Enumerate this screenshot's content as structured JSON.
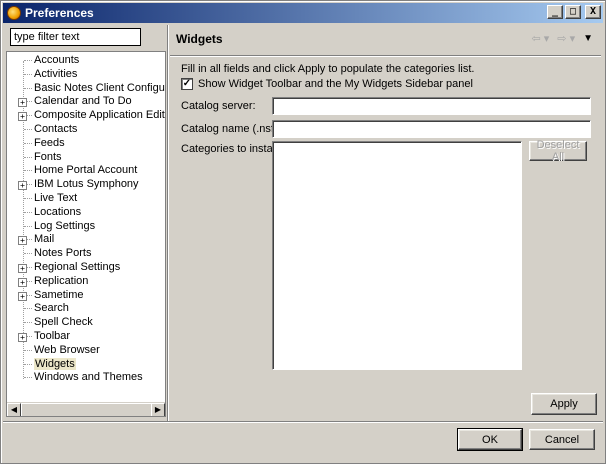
{
  "window": {
    "title": "Preferences"
  },
  "title_buttons": {
    "minimize": "_",
    "maximize": "□",
    "close": "X"
  },
  "filter": {
    "value": "type filter text"
  },
  "tree": {
    "items": [
      {
        "label": "Accounts",
        "expandable": false,
        "selected": false
      },
      {
        "label": "Activities",
        "expandable": false,
        "selected": false
      },
      {
        "label": "Basic Notes Client Configuration",
        "expandable": false,
        "selected": false
      },
      {
        "label": "Calendar and To Do",
        "expandable": true,
        "selected": false
      },
      {
        "label": "Composite Application Editor",
        "expandable": true,
        "selected": false
      },
      {
        "label": "Contacts",
        "expandable": false,
        "selected": false
      },
      {
        "label": "Feeds",
        "expandable": false,
        "selected": false
      },
      {
        "label": "Fonts",
        "expandable": false,
        "selected": false
      },
      {
        "label": "Home Portal Account",
        "expandable": false,
        "selected": false
      },
      {
        "label": "IBM Lotus Symphony",
        "expandable": true,
        "selected": false
      },
      {
        "label": "Live Text",
        "expandable": false,
        "selected": false
      },
      {
        "label": "Locations",
        "expandable": false,
        "selected": false
      },
      {
        "label": "Log Settings",
        "expandable": false,
        "selected": false
      },
      {
        "label": "Mail",
        "expandable": true,
        "selected": false
      },
      {
        "label": "Notes Ports",
        "expandable": false,
        "selected": false
      },
      {
        "label": "Regional Settings",
        "expandable": true,
        "selected": false
      },
      {
        "label": "Replication",
        "expandable": true,
        "selected": false
      },
      {
        "label": "Sametime",
        "expandable": true,
        "selected": false
      },
      {
        "label": "Search",
        "expandable": false,
        "selected": false
      },
      {
        "label": "Spell Check",
        "expandable": false,
        "selected": false
      },
      {
        "label": "Toolbar",
        "expandable": true,
        "selected": false
      },
      {
        "label": "Web Browser",
        "expandable": false,
        "selected": false
      },
      {
        "label": "Widgets",
        "expandable": false,
        "selected": true
      },
      {
        "label": "Windows and Themes",
        "expandable": false,
        "selected": false
      }
    ]
  },
  "page": {
    "title": "Widgets",
    "info": "Fill in all fields and click Apply to populate the categories list.",
    "show_toolbar": {
      "label": "Show Widget Toolbar and the My Widgets Sidebar panel",
      "checked": true
    },
    "catalog_server": {
      "label": "Catalog server:",
      "value": ""
    },
    "catalog_name": {
      "label": "Catalog name (.nsf):",
      "value": ""
    },
    "categories": {
      "label": "Categories to install:"
    },
    "deselect_all": "Deselect All",
    "apply": "Apply"
  },
  "icons": {
    "back": "back-arrow-icon",
    "forward": "forward-arrow-icon",
    "menu": "view-menu-icon"
  },
  "footer": {
    "ok": "OK",
    "cancel": "Cancel"
  }
}
